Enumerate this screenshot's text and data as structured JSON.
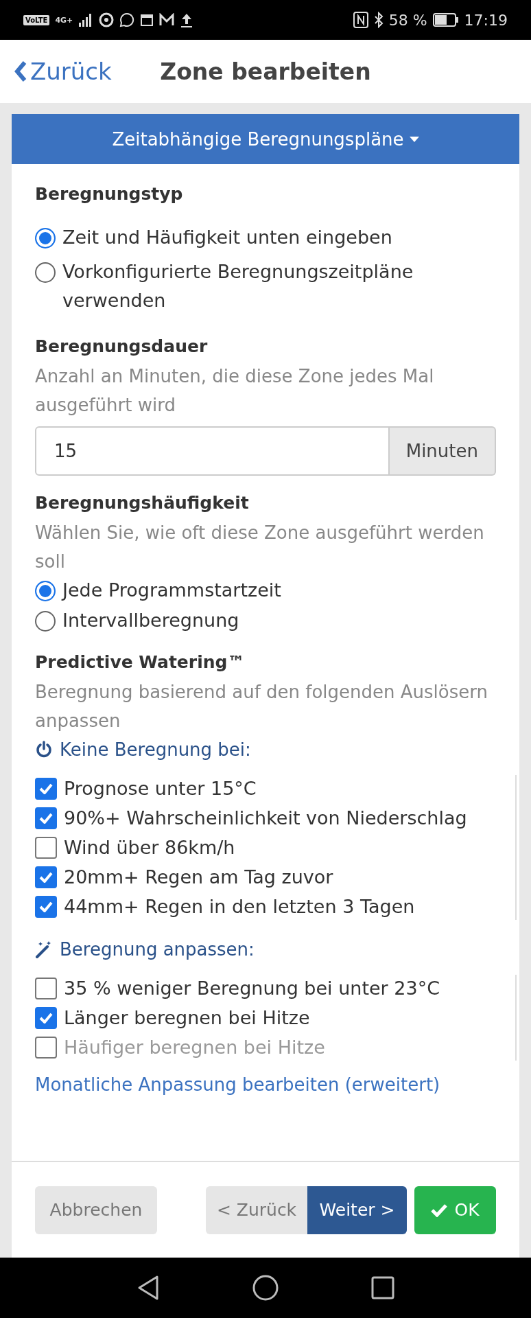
{
  "status_bar": {
    "volte": "VoLTE",
    "network": "4G+",
    "battery": "58 %",
    "time": "17:19"
  },
  "header": {
    "back": "Zurück",
    "title": "Zone bearbeiten"
  },
  "panel": {
    "title": "Zeitabhängige Beregnungspläne"
  },
  "watering_type": {
    "label": "Beregnungstyp",
    "options": [
      {
        "label": "Zeit und Häufigkeit unten eingeben",
        "selected": true
      },
      {
        "label": "Vorkonfigurierte Beregnungszeitpläne verwenden",
        "selected": false
      }
    ]
  },
  "duration": {
    "label": "Beregnungsdauer",
    "hint": "Anzahl an Minuten, die diese Zone jedes Mal ausgeführt wird",
    "value": "15",
    "unit": "Minuten"
  },
  "frequency": {
    "label": "Beregnungshäufigkeit",
    "hint": "Wählen Sie, wie oft diese Zone ausgeführt werden soll",
    "options": [
      {
        "label": "Jede Programmstartzeit",
        "selected": true
      },
      {
        "label": "Intervallberegnung",
        "selected": false
      }
    ]
  },
  "predictive": {
    "label": "Predictive Watering™",
    "hint": "Beregnung basierend auf den folgenden Auslösern anpassen",
    "groups": [
      {
        "kind": "power",
        "title": "Keine Beregnung bei:",
        "items": [
          {
            "label": "Prognose unter 15°C",
            "checked": true,
            "disabled": false
          },
          {
            "label": "90%+ Wahrscheinlichkeit von Niederschlag",
            "checked": true,
            "disabled": false
          },
          {
            "label": "Wind über 86km/h",
            "checked": false,
            "disabled": false
          },
          {
            "label": "20mm+ Regen am Tag zuvor",
            "checked": true,
            "disabled": false
          },
          {
            "label": "44mm+ Regen in den letzten 3 Tagen",
            "checked": true,
            "disabled": false
          }
        ]
      },
      {
        "kind": "wand",
        "title": "Beregnung anpassen:",
        "items": [
          {
            "label": "35 % weniger Beregnung bei unter 23°C",
            "checked": false,
            "disabled": false
          },
          {
            "label": "Länger beregnen bei Hitze",
            "checked": true,
            "disabled": false
          },
          {
            "label": "Häufiger beregnen bei Hitze",
            "checked": false,
            "disabled": true
          }
        ]
      }
    ],
    "link": "Monatliche Anpassung bearbeiten (erweitert)"
  },
  "footer": {
    "cancel": "Abbrechen",
    "back": "< Zurück",
    "next": "Weiter >",
    "ok": "OK"
  }
}
